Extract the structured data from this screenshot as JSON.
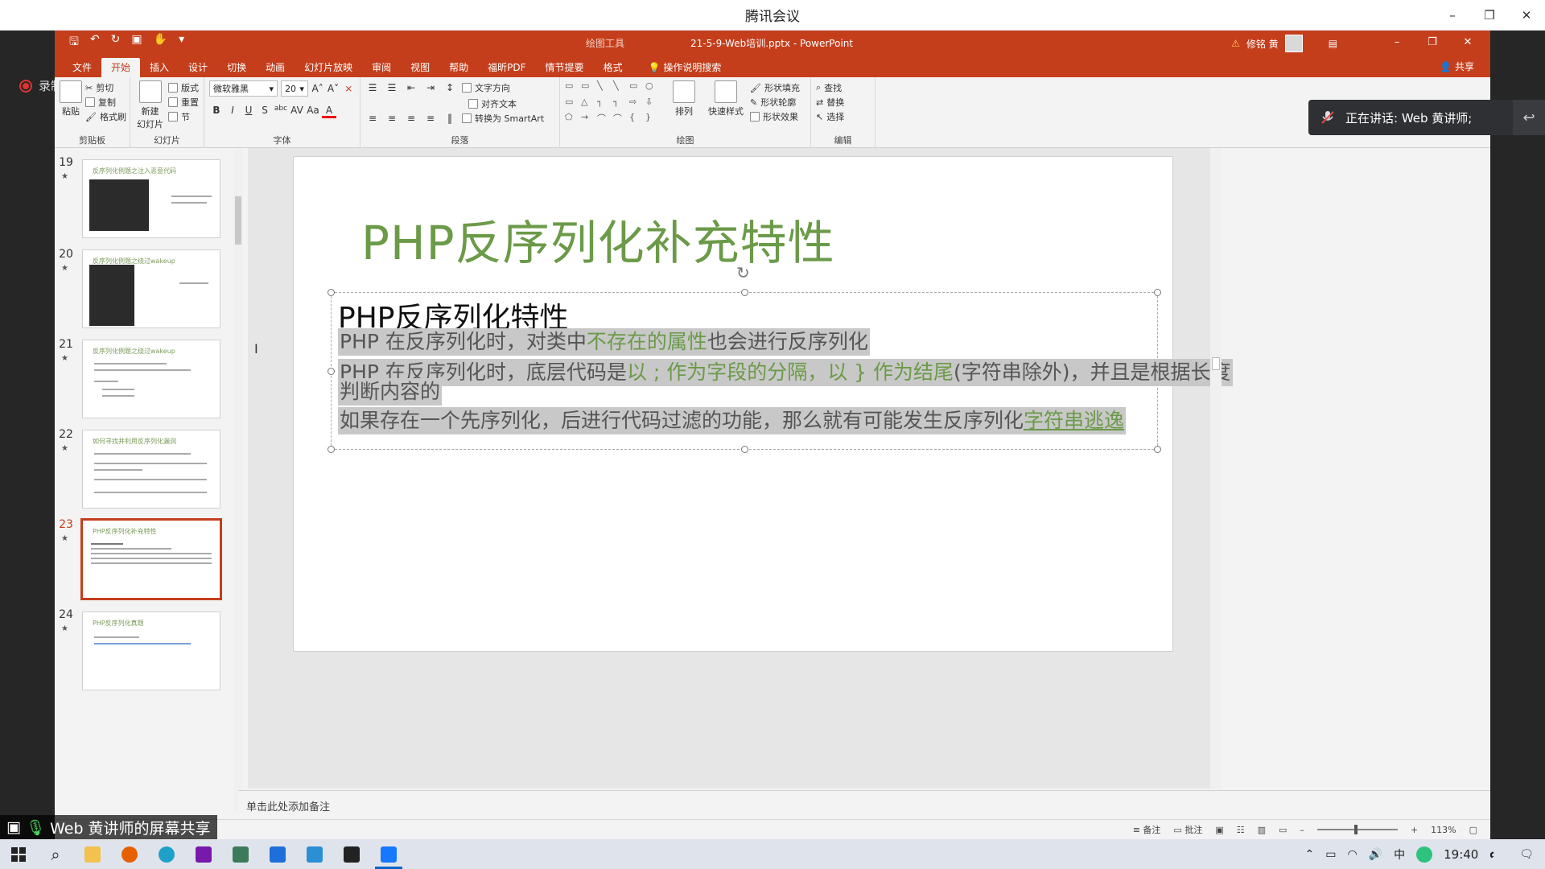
{
  "meeting": {
    "title": "腾讯会议",
    "recording_label": "录制中",
    "speaking": "正在讲话: Web 黄讲师;",
    "share_label": "Web 黄讲师的屏幕共享"
  },
  "ppt": {
    "context_tab": "绘图工具",
    "doc_title": "21-5-9-Web培训.pptx  -  PowerPoint",
    "user_name": "修铭 黄",
    "tabs": [
      "文件",
      "开始",
      "插入",
      "设计",
      "切换",
      "动画",
      "幻灯片放映",
      "审阅",
      "视图",
      "帮助",
      "福昕PDF",
      "情节提要",
      "格式"
    ],
    "active_tab": "开始",
    "tell_me": "操作说明搜索",
    "share": "共享",
    "ribbon": {
      "clipboard": {
        "paste": "粘贴",
        "cut": "剪切",
        "copy": "复制",
        "format_painter": "格式刷",
        "label": "剪贴板"
      },
      "slides": {
        "new_slide": "新建\n幻灯片",
        "layout": "版式",
        "reset": "重置",
        "section": "节",
        "label": "幻灯片"
      },
      "font": {
        "family": "微软雅黑",
        "size": "20",
        "label": "字体"
      },
      "paragraph": {
        "text_direction": "文字方向",
        "align_text": "对齐文本",
        "smartart": "转换为 SmartArt",
        "label": "段落"
      },
      "drawing": {
        "arrange": "排列",
        "quick_styles": "快速样式",
        "shape_fill": "形状填充",
        "shape_outline": "形状轮廓",
        "shape_effects": "形状效果",
        "label": "绘图"
      },
      "editing": {
        "find": "查找",
        "replace": "替换",
        "select": "选择",
        "label": "编辑"
      }
    },
    "thumbnails": [
      {
        "num": "19",
        "title": "反序列化例题之注入恶意代码"
      },
      {
        "num": "20",
        "title": "反序列化例题之绕过wakeup"
      },
      {
        "num": "21",
        "title": "反序列化例题之绕过wakeup"
      },
      {
        "num": "22",
        "title": "如何寻找并利用反序列化漏洞"
      },
      {
        "num": "23",
        "title": "PHP反序列化补充特性"
      },
      {
        "num": "24",
        "title": "PHP反序列化真题"
      }
    ],
    "slide": {
      "title": "PHP反序列化补充特性",
      "heading": "PHP反序列化特性",
      "lines": [
        {
          "pre": "PHP 在反序列化时，对类中",
          "hl": "不存在的属性",
          "post": "也会进行反序列化"
        },
        {
          "pre": "PHP 在反序列化时，底层代码是",
          "hl": "以 ; 作为字段的分隔，以 } 作为结尾",
          "post": "(字符串除外)，并且是根据长度"
        },
        {
          "pre": "判断内容的",
          "hl": "",
          "post": ""
        },
        {
          "pre": "如果存在一个先序列化，后进行代码过滤的功能，那么就有可能发生反序列化",
          "hl": "字符串逃逸",
          "post": ""
        }
      ]
    },
    "notes_placeholder": "单击此处添加备注",
    "status": {
      "notes": "备注",
      "comments": "批注",
      "zoom": "113%"
    }
  },
  "taskbar": {
    "time": "19:40",
    "ime": "中"
  }
}
